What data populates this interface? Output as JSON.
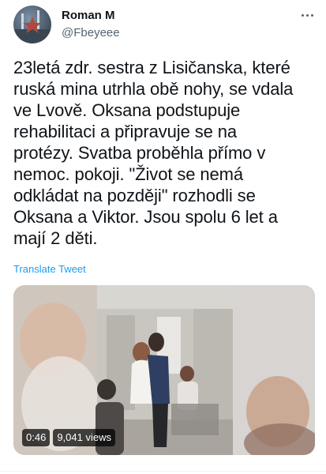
{
  "author": {
    "name": "Roman M",
    "handle": "@Fbeyeee",
    "avatar_icon": "avatar-star-icon"
  },
  "more_icon": "more-horizontal-icon",
  "tweet": {
    "text": "23letá zdr. sestra z Lisičanska, které\nruská mina utrhla obě nohy, se vdala\nve Lvově. Oksana podstupuje\nrehabilitaci a připravuje se na\nprotézy. Svatba proběhla přímo v\nnemoc. pokoji. \"Život se nemá\nodkládat na později\" rozhodli se\nOksana a Viktor. Jsou spolu 6 let a\nmají 2 děti.",
    "translate_label": "Translate Tweet"
  },
  "video": {
    "duration": "0:46",
    "views": "9,041 views"
  },
  "colors": {
    "link": "#1d9bf0",
    "secondary_text": "#536471",
    "primary_text": "#0f1419"
  }
}
